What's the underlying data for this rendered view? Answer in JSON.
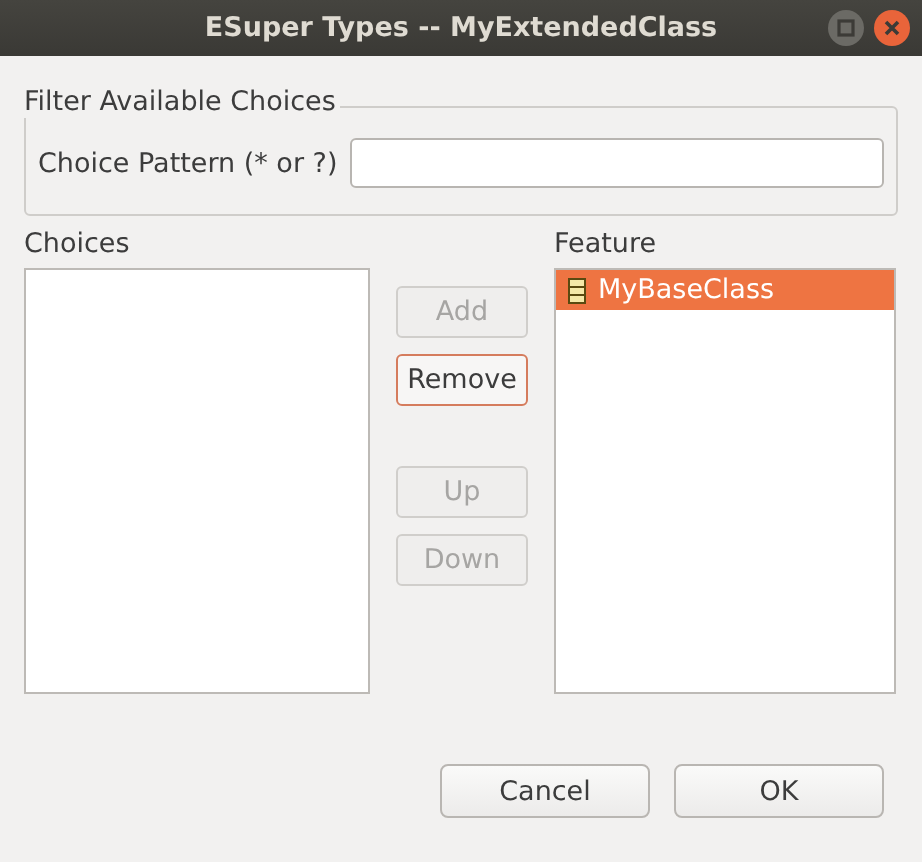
{
  "window": {
    "title": "ESuper Types -- MyExtendedClass"
  },
  "filter": {
    "title": "Filter Available Choices",
    "label": "Choice Pattern (* or ?)"
  },
  "choices": {
    "title": "Choices"
  },
  "buttons": [
    {
      "label": "Add",
      "disabled": true,
      "focused": false
    },
    {
      "label": "Remove",
      "disabled": false,
      "focused": true
    },
    {
      "label": "Up",
      "disabled": true,
      "focused": false
    },
    {
      "label": "Down",
      "disabled": true,
      "focused": false
    }
  ],
  "feature": {
    "title": "Feature",
    "items": [
      {
        "label": "MyBaseClass",
        "selected": true
      }
    ]
  },
  "footer": [
    {
      "label": "Cancel"
    },
    {
      "label": "OK"
    }
  ]
}
